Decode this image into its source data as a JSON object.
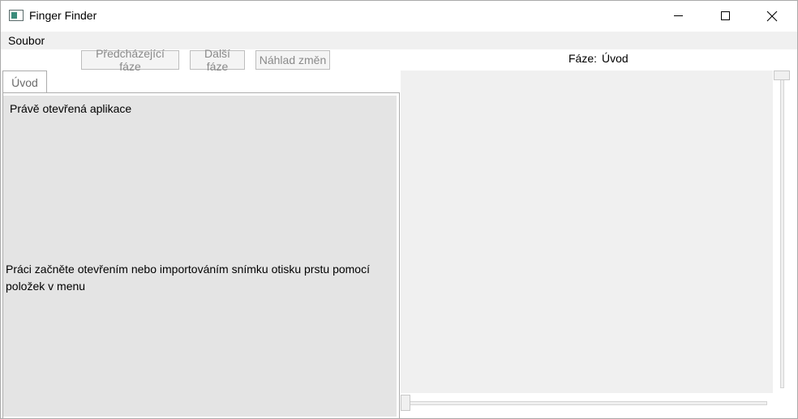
{
  "window": {
    "title": "Finger Finder",
    "icon": "app-window-icon",
    "controls": {
      "minimize": "minimize-icon",
      "maximize": "maximize-icon",
      "close": "close-icon"
    }
  },
  "menu": {
    "items": [
      {
        "label": "Soubor"
      }
    ]
  },
  "toolbar": {
    "prev_label": "Předcházející fáze",
    "next_label": "Další fáze",
    "preview_label": "Náhlad změn"
  },
  "phase": {
    "label": "Fáze:",
    "value": "Úvod"
  },
  "tabs": [
    {
      "label": "Úvod"
    }
  ],
  "panel": {
    "status": "Právě otevřená aplikace",
    "info": "Práci začněte otevřením nebo importováním snímku otisku prstu pomocí položek v menu"
  },
  "colors": {
    "panel_bg": "#e4e4e4",
    "viewer_bg": "#f0f0f0",
    "disabled_text": "#8a8a8a"
  }
}
